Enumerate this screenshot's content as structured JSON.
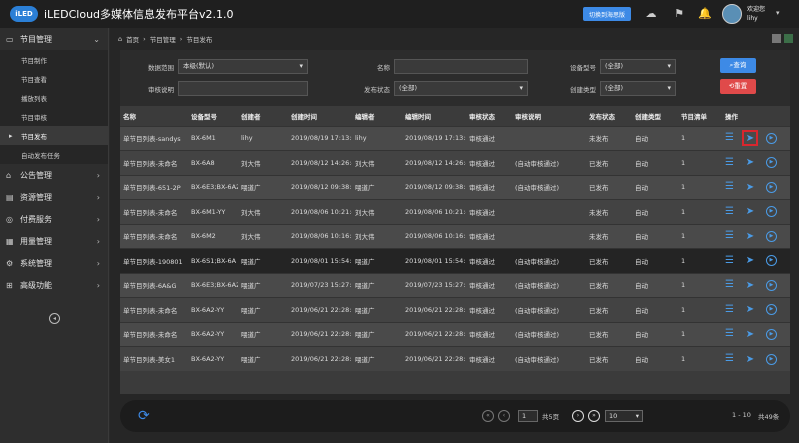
{
  "app": {
    "logo_text": "iLED",
    "title": "iLEDCloud多媒体信息发布平台v2.1.0",
    "switch_label": "切换到海思版",
    "user_greeting": "欢迎您",
    "user_name": "lihy"
  },
  "sidebar": {
    "groups": [
      {
        "label": "节目管理",
        "icon": "monitor-icon",
        "chevron": "⌄"
      },
      {
        "label": "公告管理",
        "icon": "notice-icon",
        "chevron": "›"
      },
      {
        "label": "资源管理",
        "icon": "resource-icon",
        "chevron": "›"
      },
      {
        "label": "付费服务",
        "icon": "pay-icon",
        "chevron": "›"
      },
      {
        "label": "用量管理",
        "icon": "usage-icon",
        "chevron": "›"
      },
      {
        "label": "系统管理",
        "icon": "gear-icon",
        "chevron": "›"
      },
      {
        "label": "高级功能",
        "icon": "advanced-icon",
        "chevron": "›"
      }
    ],
    "sub_items": [
      "节目制作",
      "节目查看",
      "播放列表",
      "节目审核",
      "节目发布",
      "自动发布任务"
    ],
    "active_sub": "节目发布"
  },
  "breadcrumb": [
    "首页",
    "节目管理",
    "节目发布"
  ],
  "filters": {
    "data_range_label": "数据范围",
    "data_range_value": "本级(默认)",
    "name_label": "名称",
    "name_value": "",
    "device_model_label": "设备型号",
    "device_model_value": "(全部)",
    "audit_desc_label": "审核说明",
    "audit_desc_value": "",
    "publish_status_label": "发布状态",
    "publish_status_value": "(全部)",
    "create_type_label": "创建类型",
    "create_type_value": "(全部)",
    "query_label": "查询",
    "reset_label": "重置"
  },
  "table": {
    "headers": [
      "名称",
      "设备型号",
      "创建者",
      "创建时间",
      "编辑者",
      "编辑时间",
      "审核状态",
      "审核说明",
      "发布状态",
      "创建类型",
      "节目清单",
      "操作"
    ],
    "rows": [
      [
        "单节目列表-sandys",
        "BX-6M1",
        "lihy",
        "2019/08/19 17:13:0",
        "lihy",
        "2019/08/19 17:13:0",
        "审核通过",
        "",
        "未发布",
        "自动",
        "1"
      ],
      [
        "单节目列表-未命名",
        "BX-6A8",
        "刘大伟",
        "2019/08/12 14:26:4",
        "刘大伟",
        "2019/08/12 14:26:4",
        "审核通过",
        "(自动审核通过)",
        "已发布",
        "自动",
        "1"
      ],
      [
        "单节目列表-651-2P",
        "BX-6E3;BX-6A2",
        "喂道广",
        "2019/08/12 09:38:5",
        "喂道广",
        "2019/08/12 09:38:5",
        "审核通过",
        "(自动审核通过)",
        "已发布",
        "自动",
        "1"
      ],
      [
        "单节目列表-未命名",
        "BX-6M1-YY",
        "刘大伟",
        "2019/08/06 10:21:4",
        "刘大伟",
        "2019/08/06 10:21:4",
        "审核通过",
        "",
        "未发布",
        "自动",
        "1"
      ],
      [
        "单节目列表-未命名",
        "BX-6M2",
        "刘大伟",
        "2019/08/06 10:16:2",
        "刘大伟",
        "2019/08/06 10:16:2",
        "审核通过",
        "",
        "未发布",
        "自动",
        "1"
      ],
      [
        "单节目列表-190801",
        "BX-6S1;BX-6A",
        "喂道广",
        "2019/08/01 15:54:1",
        "喂道广",
        "2019/08/01 15:54:1",
        "审核通过",
        "(自动审核通过)",
        "已发布",
        "自动",
        "1"
      ],
      [
        "单节目列表-6A&G",
        "BX-6E3;BX-6A2",
        "喂道广",
        "2019/07/23 15:27:1",
        "喂道广",
        "2019/07/23 15:27:1",
        "审核通过",
        "(自动审核通过)",
        "已发布",
        "自动",
        "1"
      ],
      [
        "单节目列表-未命名",
        "BX-6A2-YY",
        "喂道广",
        "2019/06/21 22:28:",
        "喂道广",
        "2019/06/21 22:28:",
        "审核通过",
        "(自动审核通过)",
        "已发布",
        "自动",
        "1"
      ],
      [
        "单节目列表-未命名",
        "BX-6A2-YY",
        "喂道广",
        "2019/06/21 22:28:",
        "喂道广",
        "2019/06/21 22:28:",
        "审核通过",
        "(自动审核通过)",
        "已发布",
        "自动",
        "1"
      ],
      [
        "单节目列表-美女1",
        "BX-6A2-YY",
        "喂道广",
        "2019/06/21 22:28:",
        "喂道广",
        "2019/06/21 22:28:",
        "审核通过",
        "(自动审核通过)",
        "已发布",
        "自动",
        "1"
      ]
    ]
  },
  "pager": {
    "current_page": "1",
    "total_pages_text": "共5页",
    "page_size": "10",
    "range_text": "1 - 10",
    "total_text": "共49条"
  },
  "colors": {
    "accent": "#3d8ae6",
    "danger": "#e04a4a",
    "highlight_border": "#d9262e"
  }
}
